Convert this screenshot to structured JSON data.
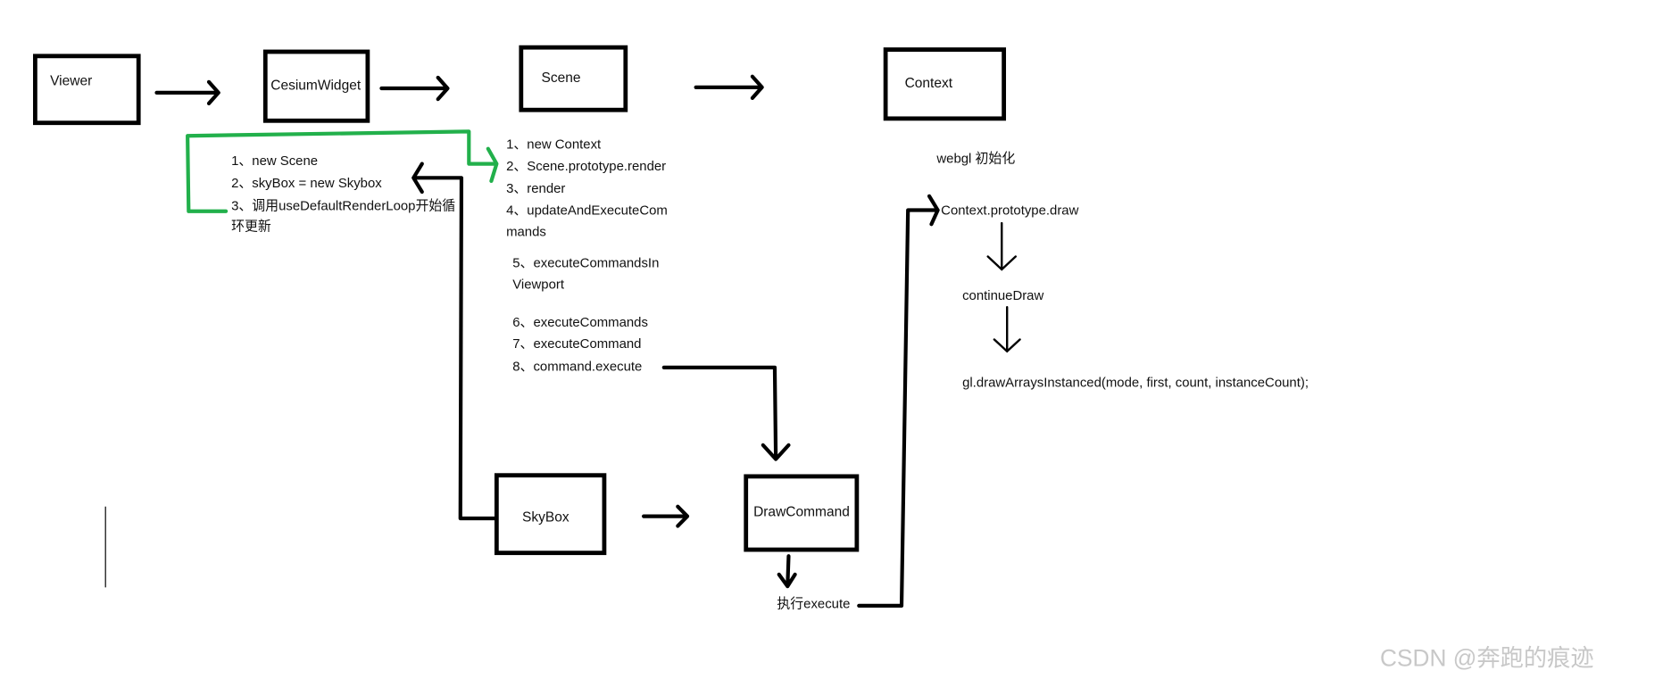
{
  "nodes": {
    "viewer": "Viewer",
    "cesium_widget": "CesiumWidget",
    "scene": "Scene",
    "context": "Context",
    "skybox": "SkyBox",
    "draw_command": "DrawCommand"
  },
  "cesium_widget_steps": [
    "1、new  Scene",
    "2、skyBox = new Skybox",
    "3、调用useDefaultRenderLoop开始循",
    "环更新"
  ],
  "scene_steps": [
    "1、new Context",
    "2、Scene.prototype.render",
    "3、render",
    "4、updateAndExecuteCom",
    "mands",
    "5、executeCommandsIn",
    "Viewport",
    "6、executeCommands",
    "7、executeCommand",
    "8、command.execute"
  ],
  "context_notes": {
    "init": "webgl 初始化",
    "draw": "Context.prototype.draw",
    "continue": "continueDraw",
    "gl_call": "gl.drawArraysInstanced(mode, first, count, instanceCount);"
  },
  "execute_label": "执行execute",
  "watermark": "CSDN @奔跑的痕迹",
  "colors": {
    "ink": "#000000",
    "highlight": "#22b04b",
    "watermark": "#c8c8c8"
  }
}
